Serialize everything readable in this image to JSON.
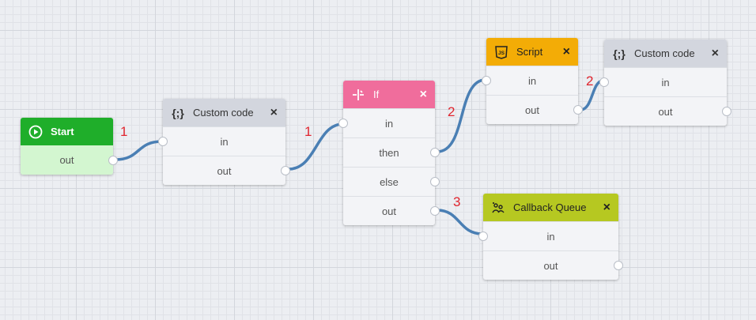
{
  "nodes": {
    "start": {
      "title": "Start",
      "ports": [
        "out"
      ],
      "color": "#1fae2a"
    },
    "custom1": {
      "title": "Custom code",
      "icon": "{;}",
      "ports": [
        "in",
        "out"
      ],
      "color": "#d3d6de"
    },
    "if": {
      "title": "If",
      "ports": [
        "in",
        "then",
        "else",
        "out"
      ],
      "color": "#f06d9c"
    },
    "script": {
      "title": "Script",
      "icon": "JS",
      "ports": [
        "in",
        "out"
      ],
      "color": "#f3ac06"
    },
    "custom2": {
      "title": "Custom code",
      "icon": "{;}",
      "ports": [
        "in",
        "out"
      ],
      "color": "#d3d6de"
    },
    "queue": {
      "title": "Callback Queue",
      "ports": [
        "in",
        "out"
      ],
      "color": "#b6c821"
    }
  },
  "close_icon": "×",
  "edge_labels": [
    "1",
    "1",
    "2",
    "2",
    "3"
  ],
  "edges": [
    {
      "from": "start.out",
      "to": "custom1.in",
      "label": "1"
    },
    {
      "from": "custom1.out",
      "to": "if.in",
      "label": "1"
    },
    {
      "from": "if.then",
      "to": "script.in",
      "label": "2"
    },
    {
      "from": "script.out",
      "to": "custom2.in",
      "label": "2"
    },
    {
      "from": "if.out",
      "to": "queue.in",
      "label": "3"
    }
  ],
  "colors": {
    "wire": "#4a7fb4",
    "edge_label": "#e0252e"
  }
}
